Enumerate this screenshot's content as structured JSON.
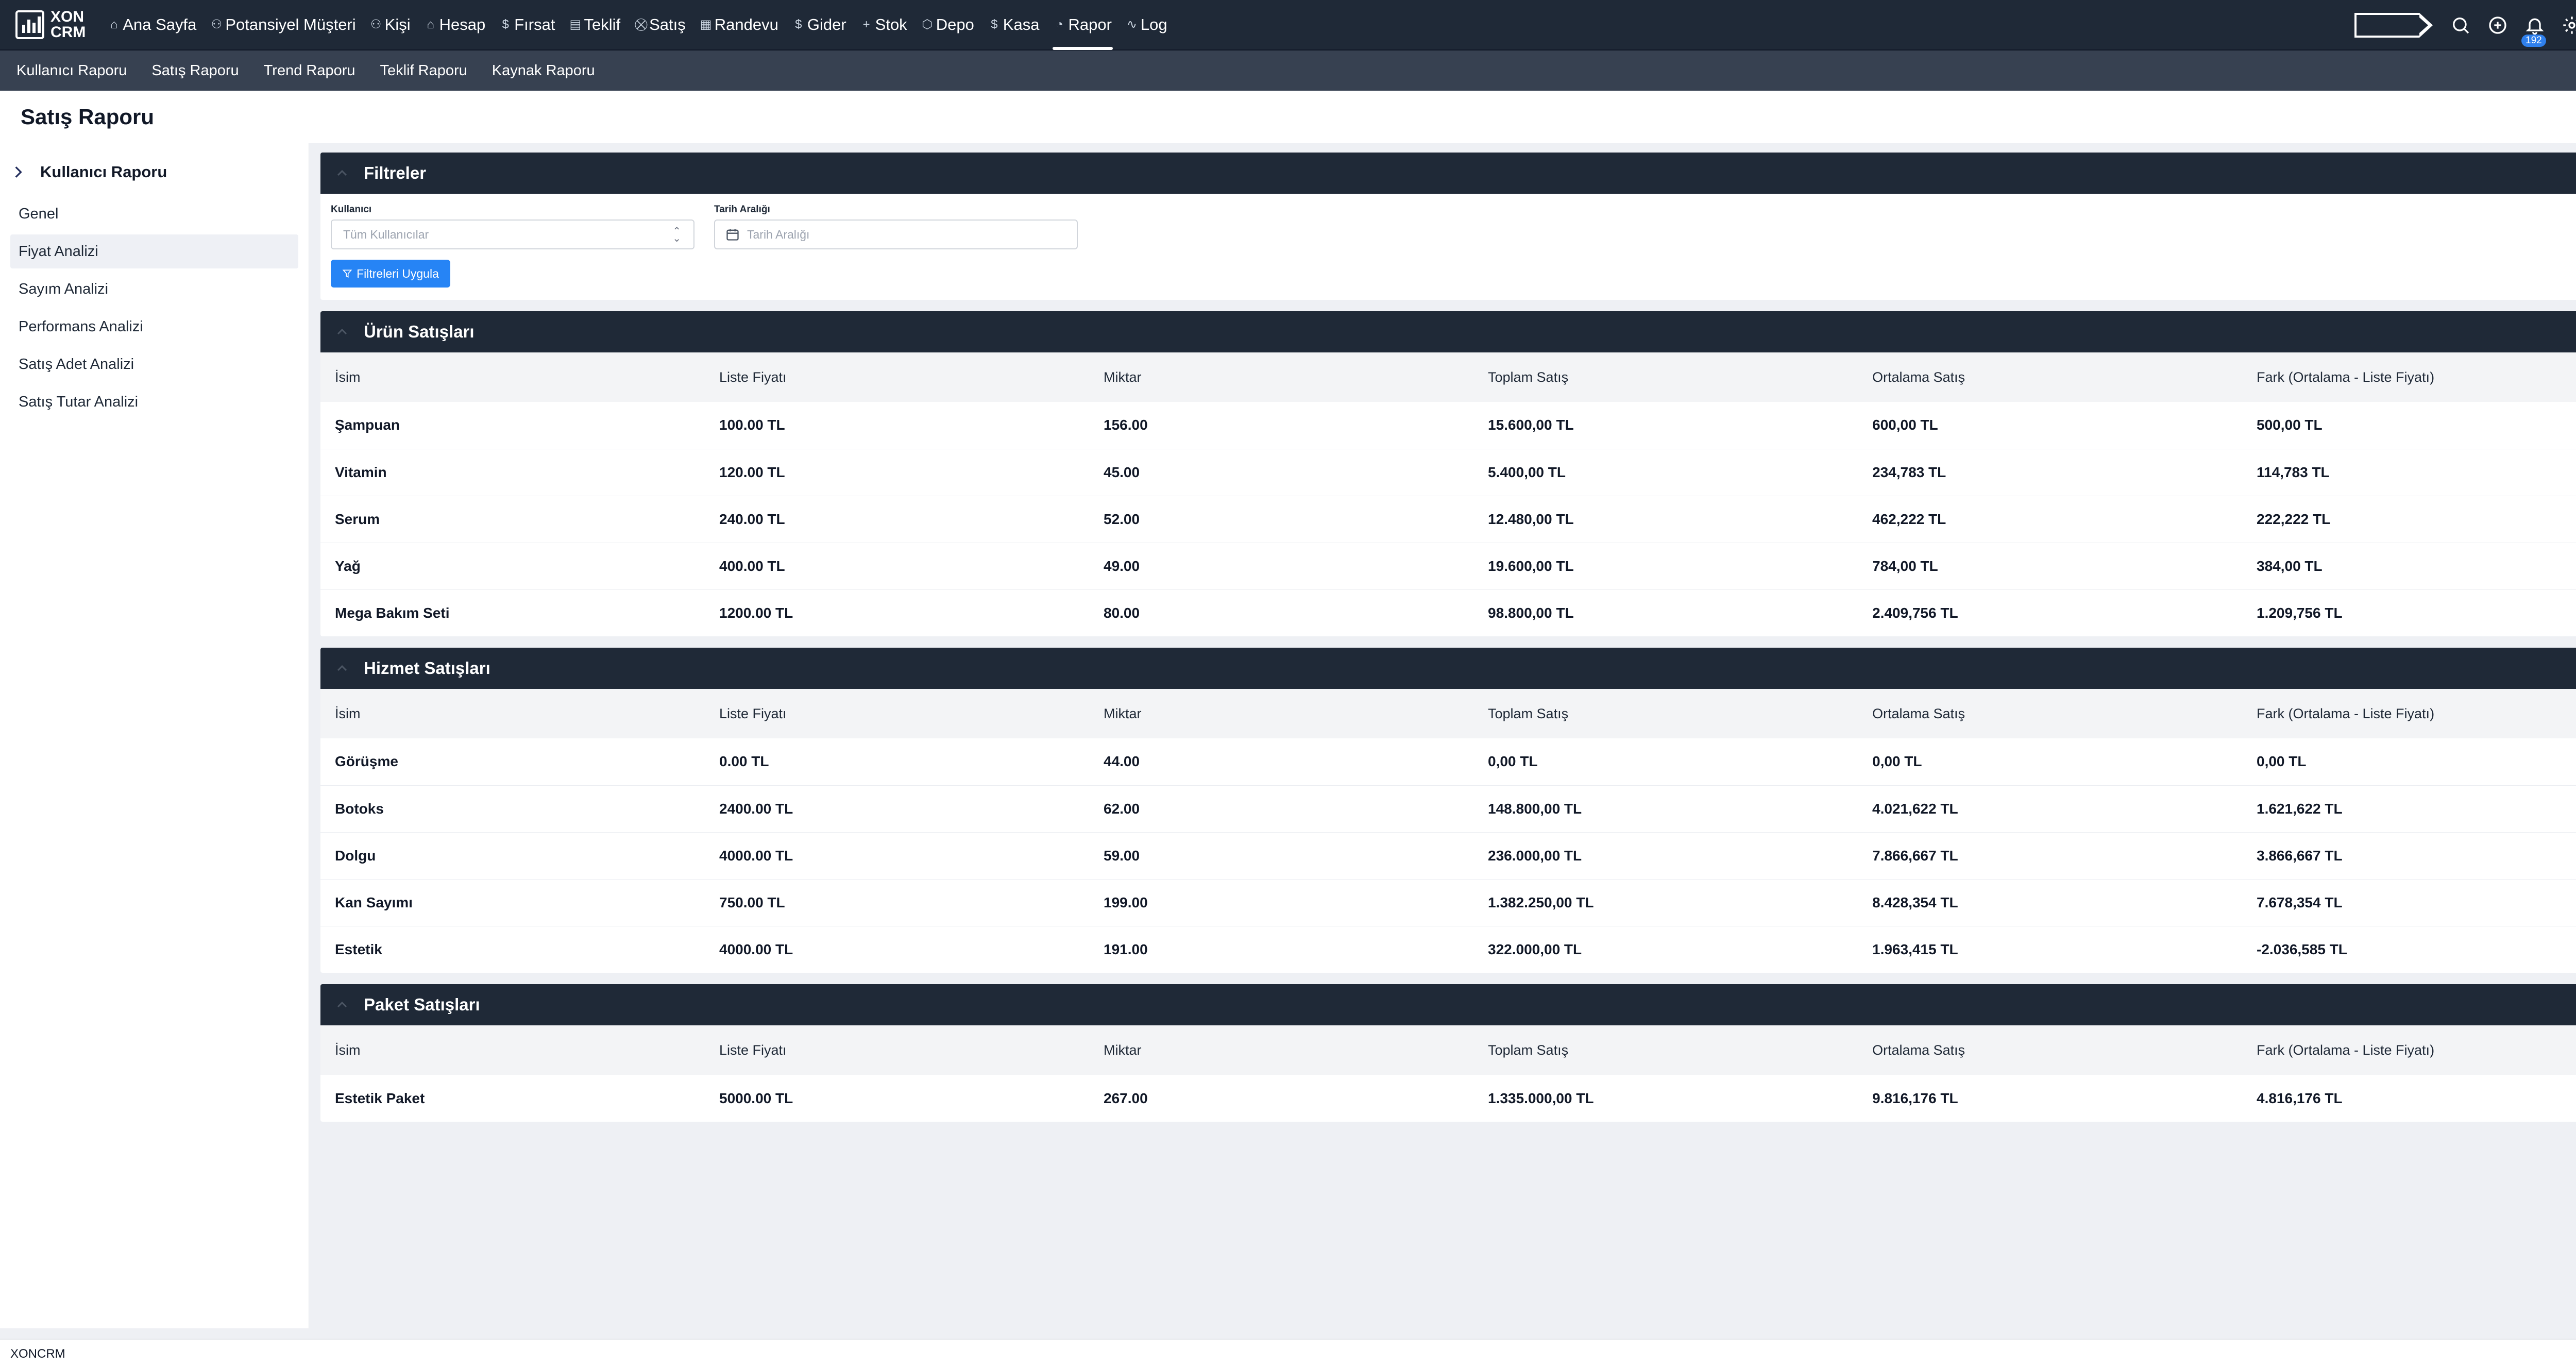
{
  "brand": {
    "line1": "XON",
    "line2": "CRM"
  },
  "nav": {
    "items": [
      {
        "label": "Ana Sayfa",
        "icon": "home-icon"
      },
      {
        "label": "Potansiyel Müşteri",
        "icon": "user-icon"
      },
      {
        "label": "Kişi",
        "icon": "users-icon"
      },
      {
        "label": "Hesap",
        "icon": "building-icon"
      },
      {
        "label": "Fırsat",
        "icon": "dollar-icon"
      },
      {
        "label": "Teklif",
        "icon": "document-icon"
      },
      {
        "label": "Satış",
        "icon": "cart-icon"
      },
      {
        "label": "Randevu",
        "icon": "calendar-icon"
      },
      {
        "label": "Gider",
        "icon": "dollar-icon"
      },
      {
        "label": "Stok",
        "icon": "plus-icon"
      },
      {
        "label": "Depo",
        "icon": "box-icon"
      },
      {
        "label": "Kasa",
        "icon": "dollar-icon"
      },
      {
        "label": "Rapor",
        "icon": "chart-icon"
      },
      {
        "label": "Log",
        "icon": "activity-icon"
      }
    ],
    "active": "Rapor",
    "notification_count": "192"
  },
  "subnav": {
    "items": [
      "Kullanıcı Raporu",
      "Satış Raporu",
      "Trend Raporu",
      "Teklif Raporu",
      "Kaynak Raporu"
    ]
  },
  "page": {
    "title": "Satış Raporu"
  },
  "sidebar": {
    "header": "Kullanıcı Raporu",
    "items": [
      "Genel",
      "Fiyat Analizi",
      "Sayım Analizi",
      "Performans Analizi",
      "Satış Adet Analizi",
      "Satış Tutar Analizi"
    ],
    "active": "Fiyat Analizi"
  },
  "filters": {
    "title": "Filtreler",
    "user_label": "Kullanıcı",
    "user_value": "Tüm Kullanıcılar",
    "date_label": "Tarih Aralığı",
    "date_placeholder": "Tarih Aralığı",
    "apply_label": "Filtreleri Uygula"
  },
  "columns": [
    "İsim",
    "Liste Fiyatı",
    "Miktar",
    "Toplam Satış",
    "Ortalama Satış",
    "Fark (Ortalama - Liste Fiyatı)"
  ],
  "sections": [
    {
      "title": "Ürün Satışları",
      "rows": [
        [
          "Şampuan",
          "100.00 TL",
          "156.00",
          "15.600,00 TL",
          "600,00 TL",
          "500,00 TL"
        ],
        [
          "Vitamin",
          "120.00 TL",
          "45.00",
          "5.400,00 TL",
          "234,783 TL",
          "114,783 TL"
        ],
        [
          "Serum",
          "240.00 TL",
          "52.00",
          "12.480,00 TL",
          "462,222 TL",
          "222,222 TL"
        ],
        [
          "Yağ",
          "400.00 TL",
          "49.00",
          "19.600,00 TL",
          "784,00 TL",
          "384,00 TL"
        ],
        [
          "Mega Bakım Seti",
          "1200.00 TL",
          "80.00",
          "98.800,00 TL",
          "2.409,756 TL",
          "1.209,756 TL"
        ]
      ]
    },
    {
      "title": "Hizmet Satışları",
      "rows": [
        [
          "Görüşme",
          "0.00 TL",
          "44.00",
          "0,00 TL",
          "0,00 TL",
          "0,00 TL"
        ],
        [
          "Botoks",
          "2400.00 TL",
          "62.00",
          "148.800,00 TL",
          "4.021,622 TL",
          "1.621,622 TL"
        ],
        [
          "Dolgu",
          "4000.00 TL",
          "59.00",
          "236.000,00 TL",
          "7.866,667 TL",
          "3.866,667 TL"
        ],
        [
          "Kan Sayımı",
          "750.00 TL",
          "199.00",
          "1.382.250,00 TL",
          "8.428,354 TL",
          "7.678,354 TL"
        ],
        [
          "Estetik",
          "4000.00 TL",
          "191.00",
          "322.000,00 TL",
          "1.963,415 TL",
          "-2.036,585 TL"
        ]
      ]
    },
    {
      "title": "Paket Satışları",
      "rows": [
        [
          "Estetik Paket",
          "5000.00 TL",
          "267.00",
          "1.335.000,00 TL",
          "9.816,176 TL",
          "4.816,176 TL"
        ]
      ]
    }
  ],
  "footer": {
    "text": "XONCRM"
  },
  "colors": {
    "nav_bg": "#1f2937",
    "subnav_bg": "#374151",
    "accent": "#2684f5",
    "page_bg": "#eef0f4"
  }
}
